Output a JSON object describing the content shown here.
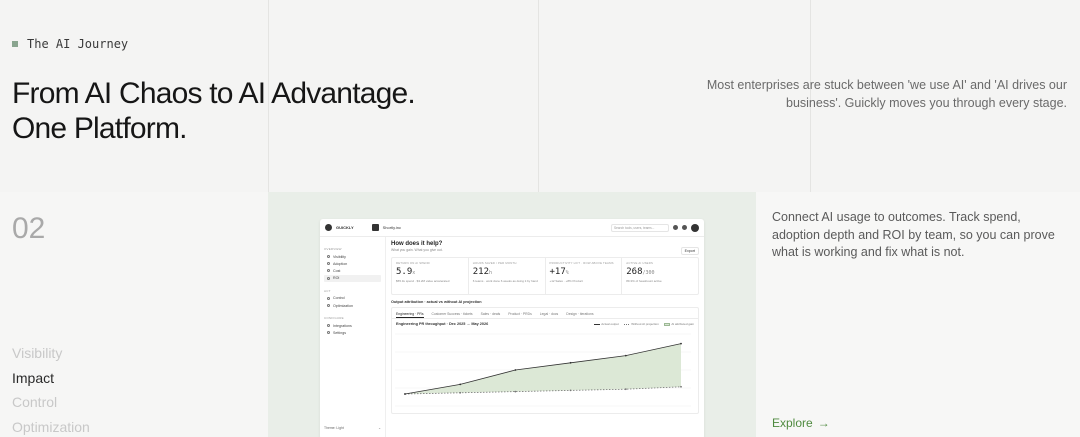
{
  "header": {
    "eyebrow": "The AI Journey",
    "headline_line1": "From AI Chaos to AI Advantage.",
    "headline_line2": "One Platform.",
    "intro": "Most enterprises are stuck between 'we use AI' and 'AI drives our business'. Guickly moves you through every stage."
  },
  "stage": {
    "number": "02",
    "items": [
      {
        "label": "Visibility",
        "active": false
      },
      {
        "label": "Impact",
        "active": true
      },
      {
        "label": "Control",
        "active": false
      },
      {
        "label": "Optimization",
        "active": false
      }
    ]
  },
  "detail": {
    "description": "Connect AI usage to outcomes. Track spend, adoption depth and ROI by team, so you can prove what is working and fix what is not.",
    "cta": "Explore",
    "cta_icon": "arrow-right-icon"
  },
  "mockup": {
    "brand": "GUICKLY",
    "org": "Shortly.inc",
    "search_placeholder": "Search tools, users, teams...",
    "sidebar": {
      "section1": "OVERVIEW",
      "items1": [
        "Visibility",
        "Adoption",
        "Cost",
        "ROI"
      ],
      "section2": "ACT",
      "items2": [
        "Control",
        "Optimization"
      ],
      "section3": "CONFIGURE",
      "items3": [
        "Integrations",
        "Settings"
      ],
      "theme_label": "Theme: Light"
    },
    "title": "How does it help?",
    "subtitle": "What you gain. What you give out.",
    "export_label": "Export",
    "kpis": [
      {
        "head": "RETURN ON AI SPEND",
        "value": "5.9",
        "unit": "x",
        "note": "$55.1k spend · $3.2M value accelerated"
      },
      {
        "head": "HOURS SAVED / PER MONTH",
        "value": "212",
        "unit": "h",
        "note": "6 teams · work done 6 weeks as doing it by hand"
      },
      {
        "head": "PRODUCTIVITY LIFT · ROW ABOVE TEAMS",
        "value": "+17",
        "unit": "%",
        "note": "+12 Sales · +8% Product"
      },
      {
        "head": "ACTIVE AI USERS",
        "value": "268",
        "unit": "/300",
        "note": "89.3% of headcount active"
      }
    ],
    "section_title": "Output attribution · actual vs without AI projection",
    "tabs": [
      "Engineering · PRs",
      "Customer Success · tickets",
      "Sales · deals",
      "Product · PRDs",
      "Legal · docs",
      "Design · iterations"
    ],
    "chart_title": "Engineering PR throughput · Dec 2025 → May 2026",
    "legend": [
      "Actual output",
      "Without AI projection",
      "AI attributed gain"
    ]
  },
  "chart_data": {
    "type": "area",
    "title": "Engineering PR throughput · Dec 2025 → May 2026",
    "series": [
      {
        "name": "Actual output",
        "values": [
          10,
          18,
          30,
          36,
          42,
          52
        ]
      },
      {
        "name": "Without AI projection",
        "values": [
          10,
          11,
          12,
          13,
          14,
          16
        ]
      }
    ],
    "categories": [
      "Dec",
      "Jan",
      "Feb",
      "Mar",
      "Apr",
      "May"
    ],
    "ylim": [
      0,
      60
    ],
    "colors": {
      "actual": "#333333",
      "projection": "#777777",
      "gain_fill": "#dce8d6"
    }
  }
}
